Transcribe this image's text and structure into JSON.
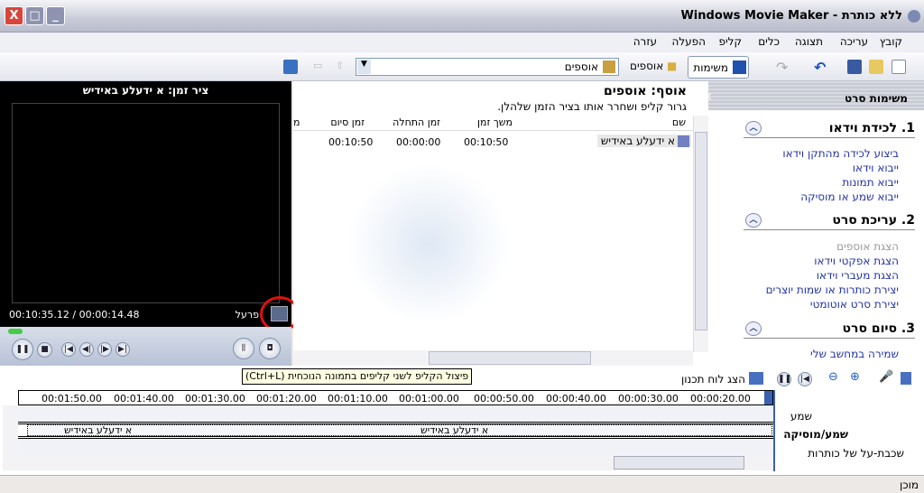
{
  "window": {
    "title": "ללא כותרת - Windows Movie Maker",
    "close": "X",
    "maximize": "□",
    "minimize": "_"
  },
  "menu": [
    "קובץ",
    "עריכה",
    "תצוגה",
    "כלים",
    "קליפ",
    "הפעלה",
    "עזרה"
  ],
  "toolbar": {
    "tasks_label": "משימות",
    "collections_label": "אוספים",
    "collection_select": "אוספים"
  },
  "preview": {
    "title": "ציר זמן: א ידעלע באידיש",
    "time": "00:10:35.12 / 00:00:14.48",
    "status": "פרעל"
  },
  "collections": {
    "title": "אוסף: אוספים",
    "hint": "גרור קליפ ושחרר אותו בציר הזמן שלהלן.",
    "columns": [
      "שם",
      "משך זמן",
      "זמן התחלה",
      "זמן סיום",
      "מ"
    ],
    "rows": [
      {
        "name": "א ידעלע באידיש",
        "duration": "00:10:50",
        "start": "00:00:00",
        "end": "00:10:50"
      }
    ]
  },
  "taskpane": {
    "title": "משימות סרט",
    "close": "×",
    "sections": [
      {
        "title": "1. לכידת וידאו",
        "items": [
          "ביצוע לכידה מהתקן וידאו",
          "ייבוא וידאו",
          "ייבוא תמונות",
          "ייבוא שמע או מוסיקה"
        ]
      },
      {
        "title": "2. עריכת סרט",
        "items": [
          "הצגת אוספים",
          "הצגת אפקטי וידאו",
          "הצגת מעברי וידאו",
          "יצירת כותרות או שמות יוצרים",
          "יצירת סרט אוטומטי"
        ]
      },
      {
        "title": "3. סיום סרט",
        "items": [
          "שמירה במחשב שלי"
        ]
      }
    ]
  },
  "tooltip": "פיצול הקליפ לשני קליפים בתמונה הנוכחית (Ctrl+L)",
  "timeline": {
    "storyboard_label": "הצג לוח תכנון",
    "ticks": [
      "00:01:50.00",
      "00:01:40.00",
      "00:01:30.00",
      "00:01:20.00",
      "00:01:10.00",
      "00:01:00.00",
      "00:00:50.00",
      "00:00:40.00",
      "00:00:30.00",
      "00:00:20.00"
    ],
    "tracks": [
      "שמע",
      "שמע/מוסיקה",
      "שכבת-על של כותרות"
    ],
    "clip_name": "א ידעלע באידיש"
  },
  "status": "מוכן"
}
